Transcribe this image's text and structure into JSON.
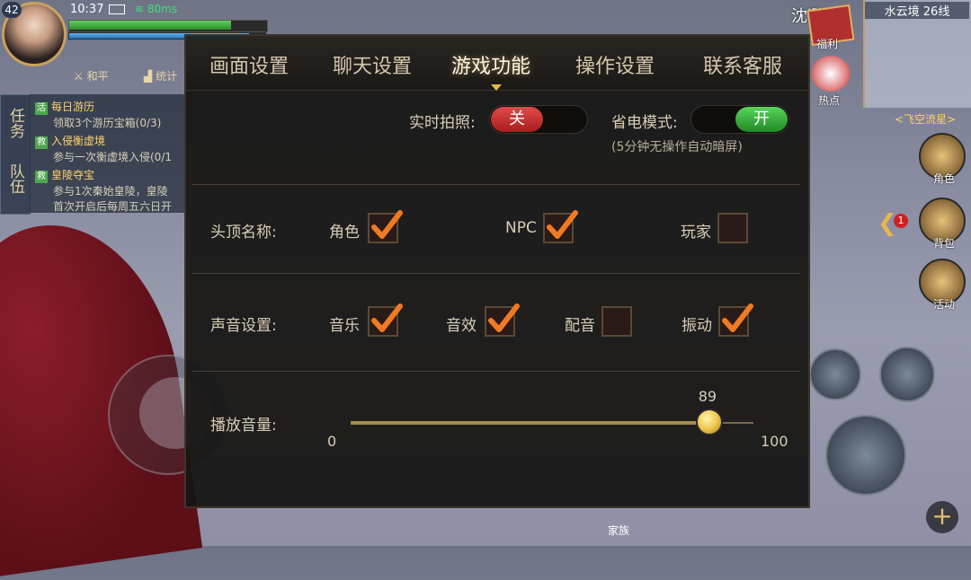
{
  "hud": {
    "level": "42",
    "time": "10:37",
    "ping": "80ms",
    "btn_peace": "和平",
    "btn_stats": "统计",
    "family": "家族"
  },
  "quests": {
    "tab_task": "任务",
    "tab_team": "队伍",
    "items": [
      {
        "badge": "活",
        "title": "每日游历",
        "sub": "领取3个游历宝箱(0/3)"
      },
      {
        "badge": "救",
        "title": "入侵衡虚境",
        "sub": "参与一次衡虚境入侵(0/1"
      },
      {
        "badge": "救",
        "title": "皇陵夺宝",
        "sub": "参与1次秦始皇陵，皇陵",
        "sub2": "首次开启后每周五六日开"
      }
    ]
  },
  "right_hud": {
    "map_name": "水云境 26线",
    "fly": "<飞空流星>",
    "welfare": "福利",
    "hot": "热点",
    "role": "角色",
    "bag": "背包",
    "activity": "活动",
    "badge_count": "1",
    "other_name": "沈逊"
  },
  "settings": {
    "tabs": [
      "画面设置",
      "聊天设置",
      "游戏功能",
      "操作设置",
      "联系客服"
    ],
    "active_tab": 2,
    "realtime_photo": {
      "label": "实时拍照:",
      "state": "关"
    },
    "power_save": {
      "label": "省电模式:",
      "state": "开",
      "hint": "(5分钟无操作自动暗屏)"
    },
    "head_name": {
      "label": "头顶名称:",
      "options": [
        {
          "label": "角色",
          "checked": true
        },
        {
          "label": "NPC",
          "checked": true
        },
        {
          "label": "玩家",
          "checked": false
        }
      ]
    },
    "sound": {
      "label": "声音设置:",
      "options": [
        {
          "label": "音乐",
          "checked": true
        },
        {
          "label": "音效",
          "checked": true
        },
        {
          "label": "配音",
          "checked": false
        },
        {
          "label": "振动",
          "checked": true
        }
      ]
    },
    "volume": {
      "label": "播放音量:",
      "value": 89,
      "min": 0,
      "max": 100,
      "value_text": "89",
      "min_text": "0",
      "max_text": "100"
    }
  },
  "colors": {
    "off": "#c62828",
    "on": "#2e9e36",
    "accent": "#e7b54f"
  }
}
